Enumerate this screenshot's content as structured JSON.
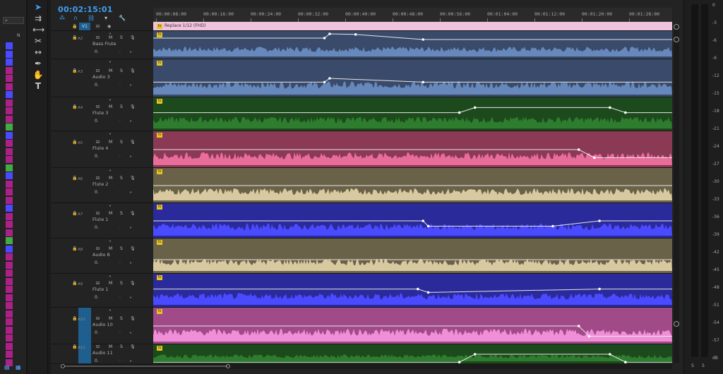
{
  "timecode": "00:02:15:01",
  "ruler_ticks": [
    "00:00:08:00",
    "00:00:16:00",
    "00:00:24:00",
    "00:00:32:00",
    "00:00:40:00",
    "00:00:48:00",
    "00:00:56:00",
    "00:01:04:00",
    "00:01:12:00",
    "00:01:20:00",
    "00:01:28:00"
  ],
  "video_track": {
    "id": "V1",
    "clip_label": "Replace 1/12 (FHD)"
  },
  "tracks": [
    {
      "id": "A2",
      "name": "Bass Flute",
      "color": "#6688bb",
      "bg": "#3a4a6a",
      "buttons": [
        "M",
        "S"
      ]
    },
    {
      "id": "A3",
      "name": "Audio 3",
      "color": "#6688bb",
      "bg": "#3a4a6a",
      "buttons": [
        "M",
        "S"
      ]
    },
    {
      "id": "A4",
      "name": "Flute 3",
      "color": "#2e7d2e",
      "bg": "#1d4a1d",
      "buttons": [
        "M",
        "S"
      ]
    },
    {
      "id": "A5",
      "name": "Flute 4",
      "color": "#e86d9a",
      "bg": "#8a3a55",
      "buttons": [
        "M",
        "S"
      ]
    },
    {
      "id": "A6",
      "name": "Flute 2",
      "color": "#d8c9a0",
      "bg": "#6a6248",
      "buttons": [
        "M",
        "S"
      ]
    },
    {
      "id": "A7",
      "name": "Flute 1",
      "color": "#4a4aff",
      "bg": "#2a2a9a",
      "buttons": [
        "M",
        "S"
      ]
    },
    {
      "id": "A8",
      "name": "Audio 8",
      "color": "#d8c9a0",
      "bg": "#6a6248",
      "buttons": [
        "M",
        "S"
      ]
    },
    {
      "id": "A9",
      "name": "Flute 1",
      "color": "#4a4aff",
      "bg": "#2a2a9a",
      "buttons": [
        "M",
        "S"
      ]
    },
    {
      "id": "A10",
      "name": "Audio 10",
      "color": "#f08ed8",
      "bg": "#a04a88",
      "buttons": [
        "M",
        "S"
      ]
    },
    {
      "id": "A11",
      "name": "Audio 11",
      "color": "#2e7d2e",
      "bg": "#1d4a1d",
      "buttons": [
        "M",
        "S"
      ]
    }
  ],
  "clip_fx_label": "fx",
  "zero_label": "0.",
  "meter": {
    "scale": [
      "0",
      "-3",
      "-6",
      "-9",
      "-12",
      "-15",
      "-18",
      "-21",
      "-24",
      "-27",
      "-30",
      "-33",
      "-36",
      "-39",
      "-42",
      "-45",
      "-48",
      "-51",
      "-54",
      "-57",
      "dB"
    ],
    "solo_labels": [
      "S",
      "S"
    ]
  },
  "left_panel_colors": [
    "#4a4aff",
    "#4a4aff",
    "#4a4aff",
    "#aa2288",
    "#aa2288",
    "#aa2288",
    "#4a4aff",
    "#aa2288",
    "#aa2288",
    "#aa2288",
    "#44aa44",
    "#4a4aff",
    "#aa2288",
    "#aa2288",
    "#aa2288",
    "#44aa44",
    "#4a4aff",
    "#aa2288",
    "#aa2288",
    "#aa2288",
    "#4a4aff",
    "#aa2288",
    "#aa2288",
    "#aa2288",
    "#44aa44",
    "#4a4aff",
    "#aa2288",
    "#aa2288",
    "#aa2288",
    "#aa2288",
    "#aa2288",
    "#aa2288",
    "#aa2288",
    "#aa2288",
    "#aa2288",
    "#aa2288",
    "#aa2288",
    "#aa2288",
    "#aa2288",
    "#aa2288"
  ],
  "left_panel_header": "N",
  "tools": [
    "selection-tool",
    "track-select-tool",
    "ripple-edit-tool",
    "razor-tool",
    "slip-tool",
    "pen-tool",
    "hand-tool",
    "type-tool"
  ]
}
